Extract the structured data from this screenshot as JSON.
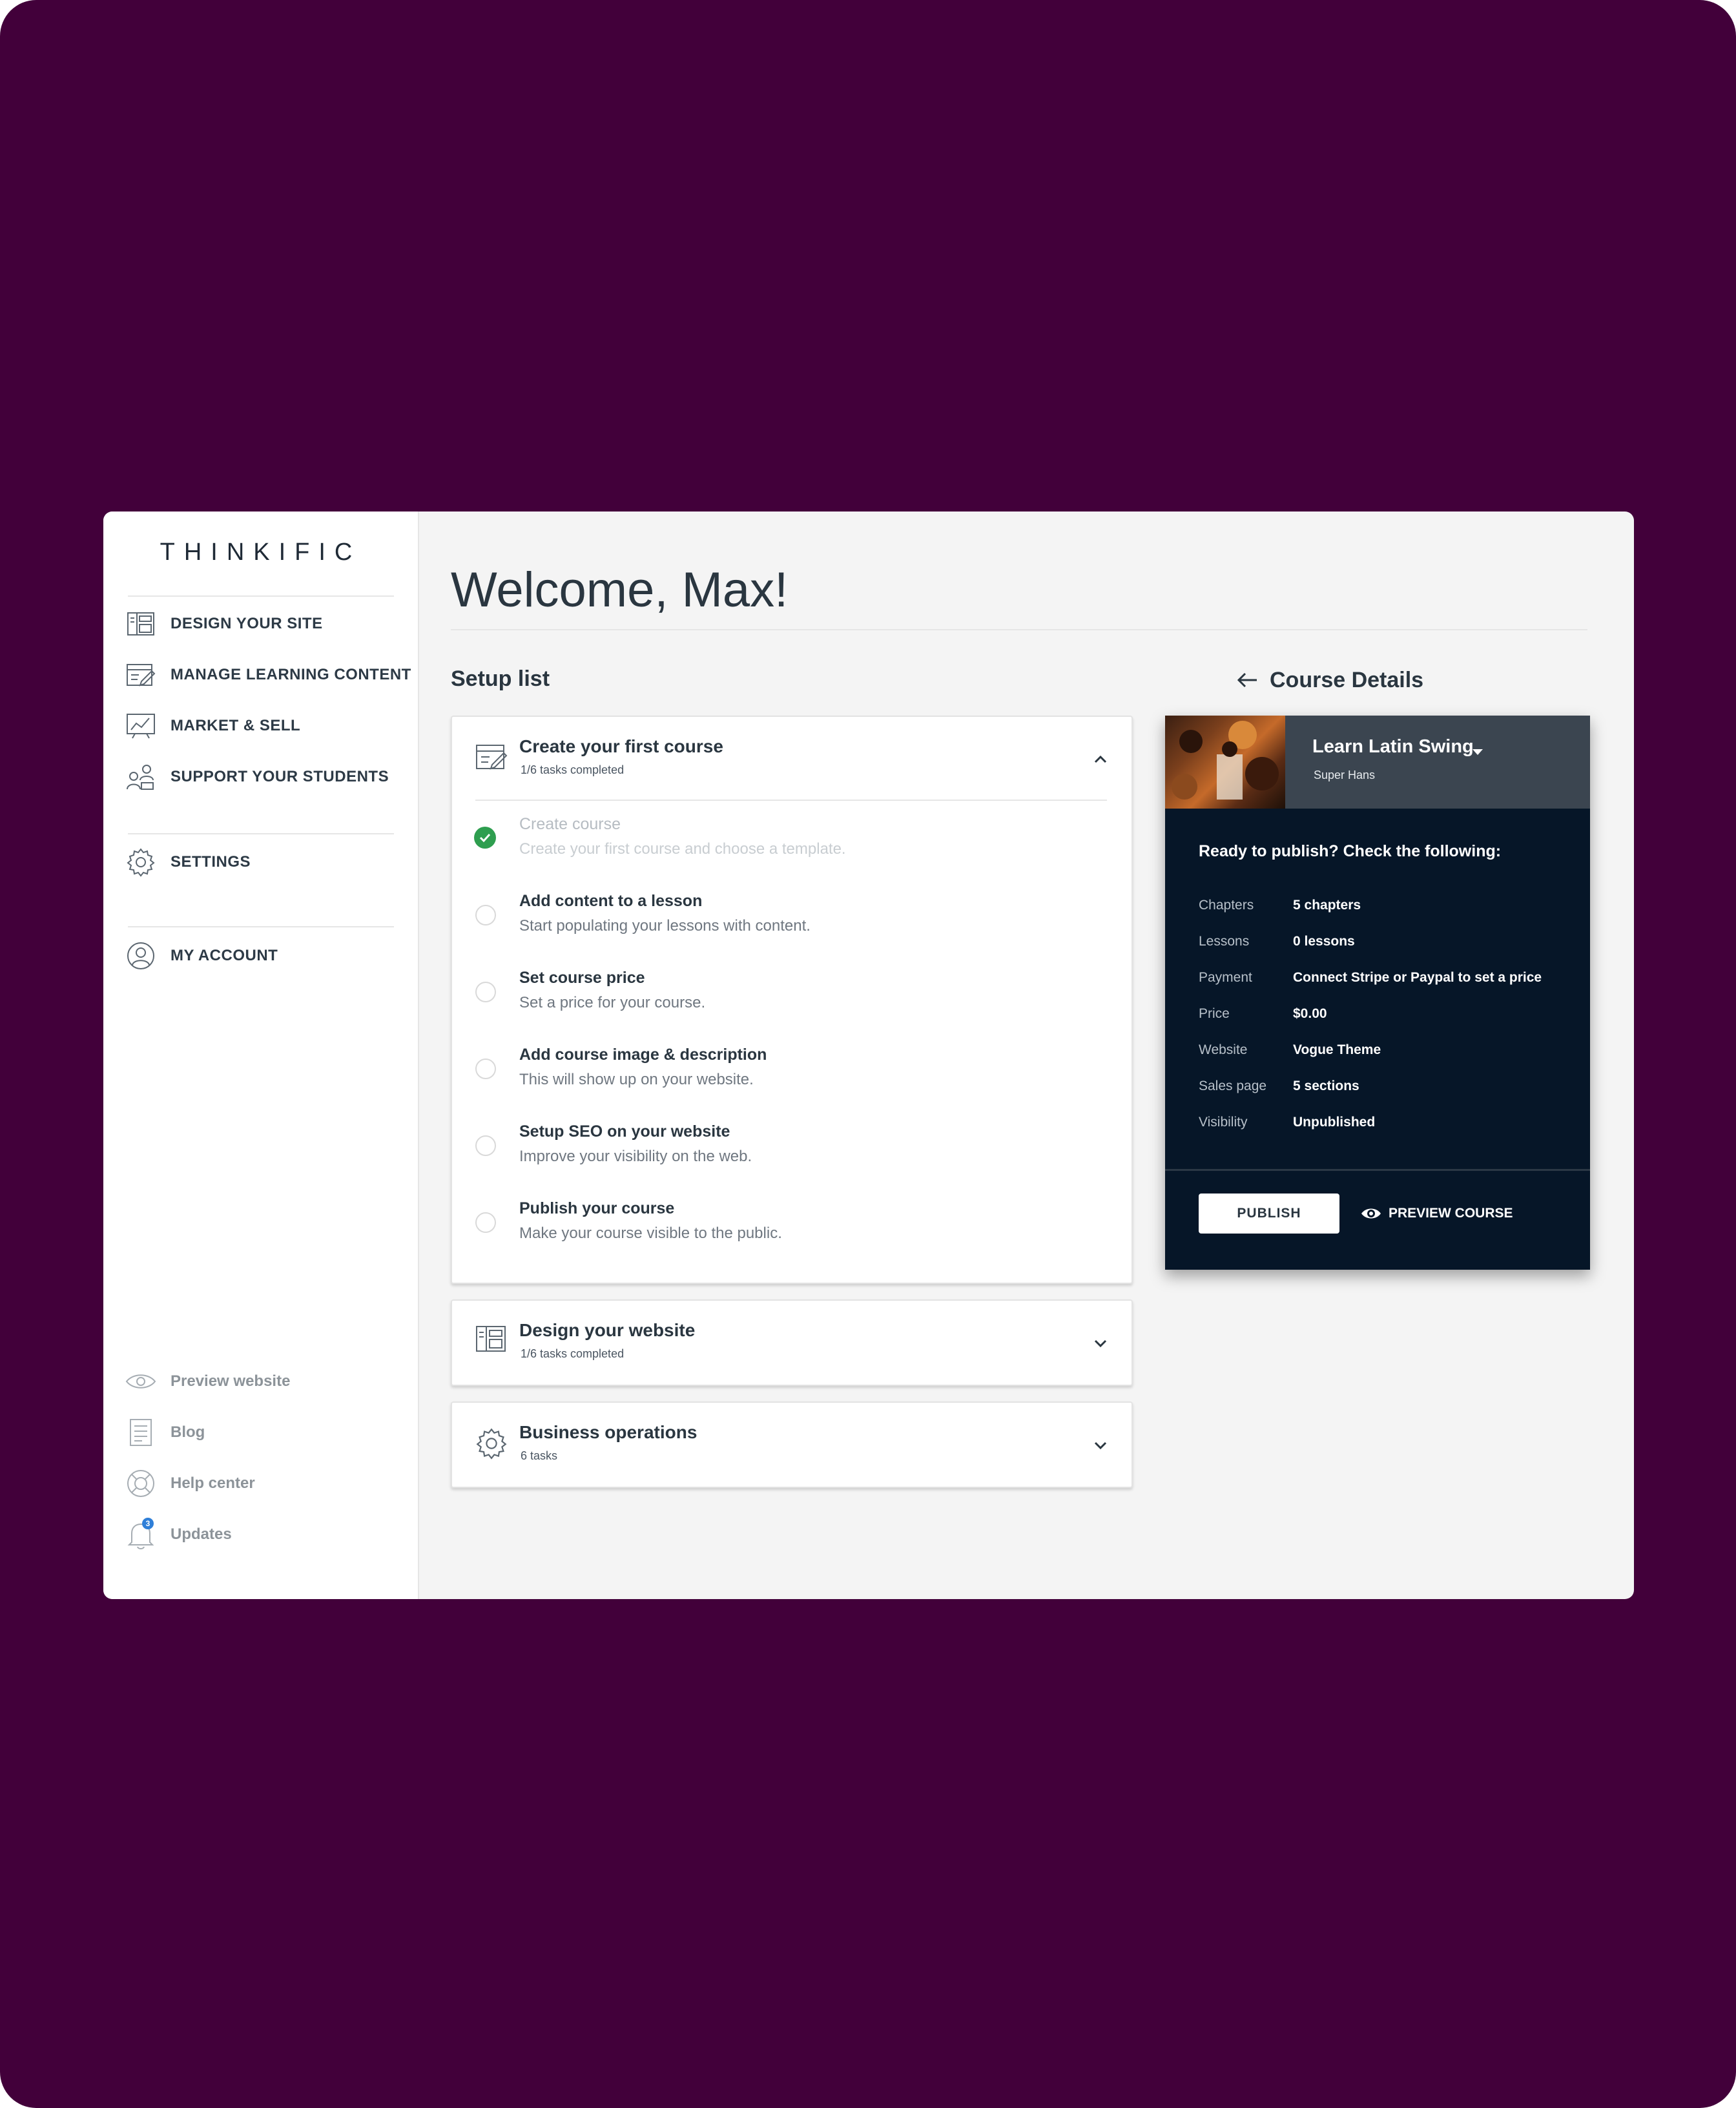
{
  "app": {
    "logo_text": "THINKIFIC"
  },
  "sidebar": {
    "nav": [
      {
        "label": "DESIGN YOUR SITE",
        "icon": "layout-icon"
      },
      {
        "label": "MANAGE LEARNING CONTENT",
        "icon": "edit-content-icon"
      },
      {
        "label": "MARKET & SELL",
        "icon": "chart-board-icon"
      },
      {
        "label": "SUPPORT YOUR STUDENTS",
        "icon": "students-icon"
      }
    ],
    "settings": {
      "label": "SETTINGS",
      "icon": "gear-icon"
    },
    "account": {
      "label": "MY ACCOUNT",
      "icon": "user-circle-icon"
    },
    "footer": [
      {
        "label": "Preview website",
        "icon": "eye-icon"
      },
      {
        "label": "Blog",
        "icon": "document-icon"
      },
      {
        "label": "Help center",
        "icon": "lifebuoy-icon"
      },
      {
        "label": "Updates",
        "icon": "bell-icon",
        "badge": "3"
      }
    ]
  },
  "main": {
    "welcome": "Welcome, Max!",
    "setup_title": "Setup list",
    "cards": [
      {
        "title": "Create your first course",
        "subtitle": "1/6 tasks completed",
        "expanded": true,
        "tasks": [
          {
            "title": "Create course",
            "desc": "Create your first course and choose a template.",
            "done": true
          },
          {
            "title": "Add content to a lesson",
            "desc": "Start populating your lessons with content.",
            "done": false
          },
          {
            "title": "Set course price",
            "desc": "Set a price for your course.",
            "done": false
          },
          {
            "title": "Add course image & description",
            "desc": "This will show up on your website.",
            "done": false
          },
          {
            "title": "Setup SEO on your website",
            "desc": "Improve your visibility on the web.",
            "done": false
          },
          {
            "title": "Publish your course",
            "desc": "Make your course visible to the public.",
            "done": false
          }
        ]
      },
      {
        "title": "Design your website",
        "subtitle": "1/6 tasks completed",
        "expanded": false
      },
      {
        "title": "Business operations",
        "subtitle": "6 tasks",
        "expanded": false
      }
    ]
  },
  "course_details": {
    "title": "Course Details",
    "course_name": "Learn Latin Swing",
    "author": "Super Hans",
    "ready_text": "Ready to publish? Check the following:",
    "rows": [
      {
        "key": "Chapters",
        "value": "5 chapters"
      },
      {
        "key": "Lessons",
        "value": "0 lessons"
      },
      {
        "key": "Payment",
        "value": "Connect Stripe or Paypal to set a price"
      },
      {
        "key": "Price",
        "value": "$0.00"
      },
      {
        "key": "Website",
        "value": "Vogue Theme"
      },
      {
        "key": "Sales page",
        "value": "5 sections"
      },
      {
        "key": "Visibility",
        "value": "Unpublished"
      }
    ],
    "publish_label": "PUBLISH",
    "preview_label": "PREVIEW COURSE"
  },
  "colors": {
    "background": "#42003a",
    "panel": "#061628",
    "success": "#2e9e4f"
  }
}
